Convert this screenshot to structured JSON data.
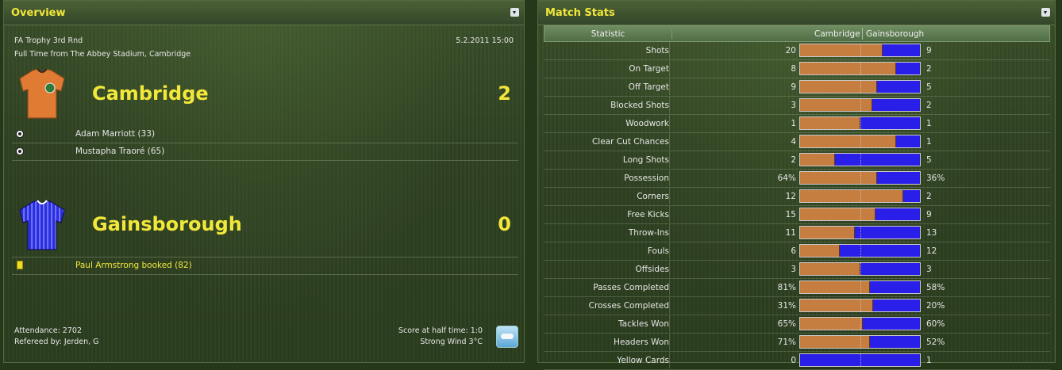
{
  "overview": {
    "title": "Overview",
    "competition": "FA Trophy 3rd Rnd",
    "datetime": "5.2.2011 15:00",
    "result_line": "Full Time from The Abbey Stadium, Cambridge",
    "home": {
      "name": "Cambridge",
      "score": "2",
      "shirt_color": "#e07b34",
      "events": [
        {
          "type": "goal",
          "text": "Adam Marriott (33)"
        },
        {
          "type": "goal",
          "text": "Mustapha Traoré (65)"
        }
      ]
    },
    "away": {
      "name": "Gainsborough",
      "score": "0",
      "shirt_color": "#2a2ee0",
      "events": [
        {
          "type": "yellow-card",
          "text": "Paul Armstrong booked (82)"
        }
      ]
    },
    "attendance": "Attendance: 2702",
    "referee": "Refereed by: Jerden, G",
    "half_time": "Score at half time: 1:0",
    "weather": "Strong Wind 3°C"
  },
  "stats": {
    "title": "Match Stats",
    "header": {
      "stat": "Statistic",
      "home": "Cambridge",
      "away": "Gainsborough"
    },
    "colors": {
      "home": "#c67d40",
      "away": "#2a1fe8"
    },
    "rows": [
      {
        "label": "Shots",
        "home": "20",
        "away": "9",
        "home_share": 0.69
      },
      {
        "label": "On Target",
        "home": "8",
        "away": "2",
        "home_share": 0.8
      },
      {
        "label": "Off Target",
        "home": "9",
        "away": "5",
        "home_share": 0.64
      },
      {
        "label": "Blocked Shots",
        "home": "3",
        "away": "2",
        "home_share": 0.6
      },
      {
        "label": "Woodwork",
        "home": "1",
        "away": "1",
        "home_share": 0.5
      },
      {
        "label": "Clear Cut Chances",
        "home": "4",
        "away": "1",
        "home_share": 0.8
      },
      {
        "label": "Long Shots",
        "home": "2",
        "away": "5",
        "home_share": 0.29
      },
      {
        "label": "Possession",
        "home": "64%",
        "away": "36%",
        "home_share": 0.64
      },
      {
        "label": "Corners",
        "home": "12",
        "away": "2",
        "home_share": 0.86
      },
      {
        "label": "Free Kicks",
        "home": "15",
        "away": "9",
        "home_share": 0.63
      },
      {
        "label": "Throw-Ins",
        "home": "11",
        "away": "13",
        "home_share": 0.46
      },
      {
        "label": "Fouls",
        "home": "6",
        "away": "12",
        "home_share": 0.33
      },
      {
        "label": "Offsides",
        "home": "3",
        "away": "3",
        "home_share": 0.5
      },
      {
        "label": "Passes Completed",
        "home": "81%",
        "away": "58%",
        "home_share": 0.58
      },
      {
        "label": "Crosses Completed",
        "home": "31%",
        "away": "20%",
        "home_share": 0.61
      },
      {
        "label": "Tackles Won",
        "home": "65%",
        "away": "60%",
        "home_share": 0.52
      },
      {
        "label": "Headers Won",
        "home": "71%",
        "away": "52%",
        "home_share": 0.58
      },
      {
        "label": "Yellow Cards",
        "home": "0",
        "away": "1",
        "home_share": 0.0
      }
    ]
  }
}
